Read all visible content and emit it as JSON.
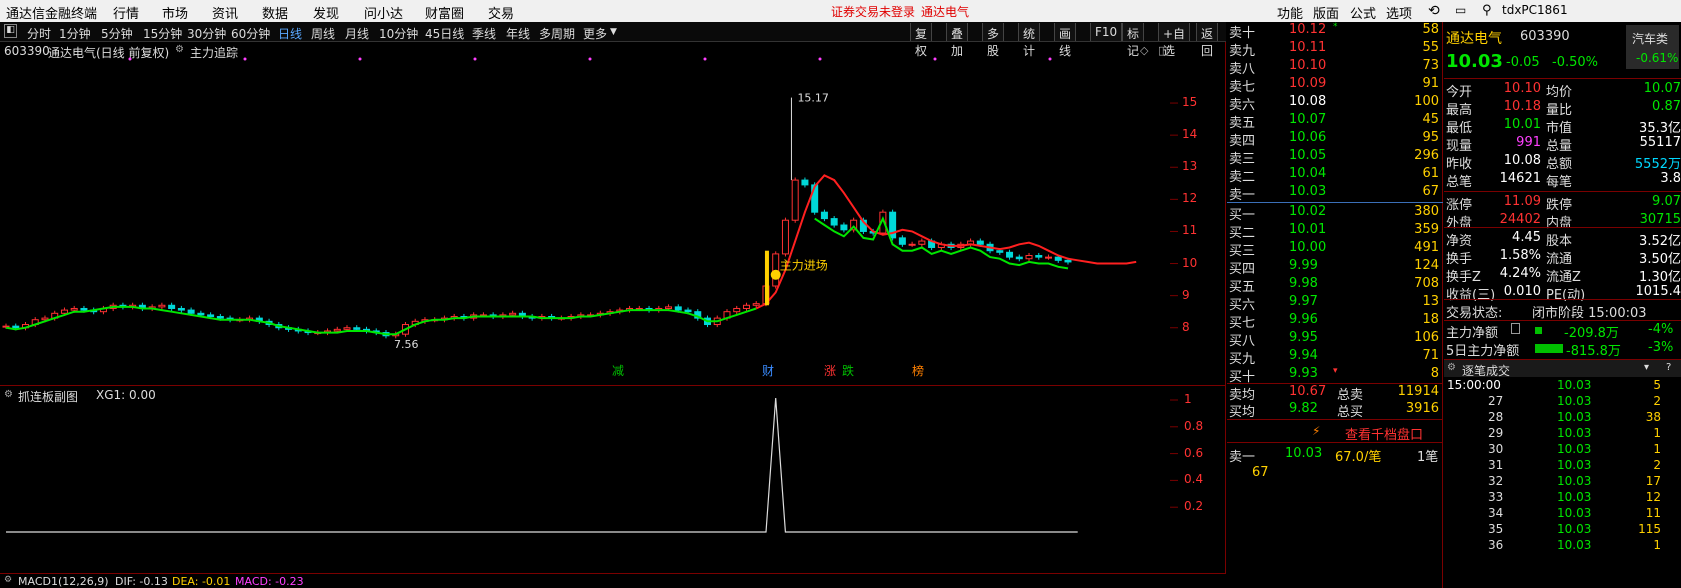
{
  "menu": {
    "app_title": "通达信金融终端",
    "items": [
      "行情",
      "市场",
      "资讯",
      "数据",
      "发现",
      "问小达",
      "财富圈",
      "交易"
    ],
    "notice_login": "证券交易未登录",
    "notice_name": "通达电气",
    "right_items": [
      "功能",
      "版面",
      "公式",
      "选项"
    ],
    "user": "tdxPC1861"
  },
  "periods": [
    "分时",
    "1分钟",
    "5分钟",
    "15分钟",
    "30分钟",
    "60分钟",
    "日线",
    "周线",
    "月线",
    "10分钟",
    "45日线",
    "季线",
    "年线",
    "多周期",
    "更多"
  ],
  "active_period": "日线",
  "toolbar": [
    "复权",
    "叠加",
    "多股",
    "统计",
    "画线",
    "F10",
    "标记",
    "+自选",
    "返回"
  ],
  "chart_header": {
    "code": "603390",
    "name_label": "通达电气(日线 前复权)",
    "indicator": "主力追踪"
  },
  "chart_data": [
    {
      "type": "candlestick",
      "y_range": [
        7.4,
        15.5
      ],
      "y_ticks": [
        15.0,
        14.0,
        13.0,
        12.0,
        11.0,
        10.0,
        9.0,
        8.0
      ],
      "high_label": "15.17",
      "low_label": "7.56",
      "signal_label": "主力进场",
      "event_tags": [
        {
          "text": "减",
          "color": "#00c000"
        },
        {
          "text": "财",
          "color": "#3b8cff"
        },
        {
          "text": "涨",
          "color": "#ff3232"
        },
        {
          "text": "跌",
          "color": "#00c000"
        },
        {
          "text": "榜",
          "color": "#ff8000"
        }
      ],
      "closes": [
        8.05,
        8.0,
        8.1,
        8.25,
        8.3,
        8.45,
        8.55,
        8.6,
        8.55,
        8.5,
        8.6,
        8.7,
        8.65,
        8.7,
        8.6,
        8.65,
        8.7,
        8.6,
        8.55,
        8.45,
        8.4,
        8.35,
        8.3,
        8.25,
        8.25,
        8.3,
        8.2,
        8.1,
        8.0,
        7.95,
        7.9,
        7.85,
        7.85,
        7.9,
        7.95,
        8.0,
        7.95,
        7.9,
        7.85,
        7.75,
        7.8,
        8.1,
        8.2,
        8.25,
        8.25,
        8.3,
        8.35,
        8.3,
        8.4,
        8.4,
        8.35,
        8.4,
        8.45,
        8.35,
        8.3,
        8.35,
        8.3,
        8.3,
        8.35,
        8.4,
        8.4,
        8.45,
        8.5,
        8.55,
        8.6,
        8.6,
        8.55,
        8.6,
        8.65,
        8.55,
        8.5,
        8.3,
        8.1,
        8.3,
        8.5,
        8.6,
        8.7,
        8.75,
        9.3,
        10.3,
        11.35,
        12.6,
        12.45,
        11.6,
        11.4,
        11.2,
        11.05,
        11.35,
        11.0,
        10.95,
        11.6,
        10.8,
        10.6,
        10.6,
        10.7,
        10.5,
        10.6,
        10.5,
        10.6,
        10.7,
        10.6,
        10.4,
        10.35,
        10.2,
        10.15,
        10.25,
        10.2,
        10.2,
        10.1,
        10.05
      ],
      "ma_green": [
        8.0,
        7.95,
        8.0,
        8.1,
        8.2,
        8.3,
        8.4,
        8.5,
        8.5,
        8.55,
        8.6,
        8.65,
        8.65,
        8.65,
        8.6,
        8.6,
        8.55,
        8.5,
        8.45,
        8.4,
        8.35,
        8.3,
        8.25,
        8.25,
        8.25,
        8.25,
        8.2,
        8.15,
        8.05,
        8.0,
        7.95,
        7.9,
        7.85,
        7.85,
        7.85,
        7.9,
        7.9,
        7.9,
        7.85,
        7.8,
        7.8,
        7.95,
        8.1,
        8.2,
        8.25,
        8.25,
        8.3,
        8.3,
        8.35,
        8.35,
        8.35,
        8.35,
        8.35,
        8.35,
        8.35,
        8.3,
        8.3,
        8.3,
        8.3,
        8.35,
        8.35,
        8.4,
        8.45,
        8.5,
        8.55,
        8.55,
        8.55,
        8.55,
        8.55,
        8.5,
        8.45,
        8.35,
        8.2,
        8.2,
        8.3,
        8.4,
        8.5,
        8.6
      ],
      "ma_red": [
        8.6,
        8.75,
        9.1,
        9.8,
        10.7,
        11.6,
        12.4,
        12.75,
        12.6,
        12.2,
        11.75,
        11.3,
        11.0,
        10.9,
        10.95,
        11.05,
        11.0,
        10.85,
        10.7,
        10.6,
        10.55,
        10.55,
        10.6,
        10.55,
        10.5,
        10.45,
        10.5,
        10.6,
        10.65,
        10.55,
        10.4,
        10.25,
        10.15,
        10.1,
        10.05,
        10.0,
        10.0,
        10.0,
        10.0,
        10.05
      ],
      "dots": 9
    },
    {
      "type": "area",
      "name": "抓连板副图",
      "label": "XG1: 0.00",
      "y_ticks": [
        1.0,
        0.8,
        0.6,
        0.4,
        0.2
      ],
      "values": [
        0,
        0,
        0,
        0,
        0,
        0,
        0,
        0,
        0,
        0,
        0,
        0,
        0,
        0,
        0,
        0,
        0,
        0,
        0,
        0,
        0,
        0,
        0,
        0,
        0,
        0,
        0,
        0,
        0,
        0,
        0,
        0,
        0,
        0,
        0,
        0,
        0,
        0,
        0,
        0,
        0,
        0,
        0,
        0,
        0,
        0,
        0,
        0,
        0,
        0,
        0,
        0,
        0,
        0,
        0,
        0,
        0,
        0,
        0,
        0,
        0,
        0,
        0,
        0,
        0,
        0,
        0,
        0,
        0,
        0,
        0,
        0,
        0,
        0,
        0,
        0,
        0,
        0,
        0,
        1,
        0,
        0,
        0,
        0,
        0,
        0,
        0,
        0,
        0,
        0,
        0,
        0,
        0,
        0,
        0,
        0,
        0,
        0,
        0,
        0,
        0,
        0,
        0,
        0,
        0,
        0,
        0,
        0,
        0,
        0,
        0
      ]
    }
  ],
  "macd": {
    "name": "MACD1(12,26,9)",
    "dif": "DIF: -0.13",
    "dea": "DEA: -0.01",
    "macd": "MACD: -0.23"
  },
  "orderbook": {
    "asks": [
      {
        "l": "卖十",
        "p": "10.12",
        "v": "58",
        "mark": "*"
      },
      {
        "l": "卖九",
        "p": "10.11",
        "v": "55"
      },
      {
        "l": "卖八",
        "p": "10.10",
        "v": "73"
      },
      {
        "l": "卖七",
        "p": "10.09",
        "v": "91"
      },
      {
        "l": "卖六",
        "p": "10.08",
        "v": "100"
      },
      {
        "l": "卖五",
        "p": "10.07",
        "v": "45"
      },
      {
        "l": "卖四",
        "p": "10.06",
        "v": "95"
      },
      {
        "l": "卖三",
        "p": "10.05",
        "v": "296"
      },
      {
        "l": "卖二",
        "p": "10.04",
        "v": "61"
      },
      {
        "l": "卖一",
        "p": "10.03",
        "v": "67"
      }
    ],
    "bids": [
      {
        "l": "买一",
        "p": "10.02",
        "v": "380"
      },
      {
        "l": "买二",
        "p": "10.01",
        "v": "359"
      },
      {
        "l": "买三",
        "p": "10.00",
        "v": "491"
      },
      {
        "l": "买四",
        "p": "9.99",
        "v": "124"
      },
      {
        "l": "买五",
        "p": "9.98",
        "v": "708"
      },
      {
        "l": "买六",
        "p": "9.97",
        "v": "13"
      },
      {
        "l": "买七",
        "p": "9.96",
        "v": "18"
      },
      {
        "l": "买八",
        "p": "9.95",
        "v": "106"
      },
      {
        "l": "买九",
        "p": "9.94",
        "v": "71"
      },
      {
        "l": "买十",
        "p": "9.93",
        "v": "8",
        "mark": "▾"
      }
    ],
    "avg": [
      {
        "l": "卖均",
        "p": "10.67",
        "k": "总卖",
        "v": "11914"
      },
      {
        "l": "买均",
        "p": "9.82",
        "k": "总买",
        "v": "3916"
      }
    ],
    "level_btn": "查看千档盘口",
    "detail": {
      "l": "卖一",
      "p": "10.03",
      "q": "67.0/笔",
      "n": "1笔",
      "sub": "67"
    }
  },
  "quote": {
    "name": "通达电气",
    "code": "603390",
    "sector": "汽车类",
    "price": "10.03",
    "chg": "-0.05",
    "pct": "-0.50%",
    "sector_pct": "-0.61%",
    "rows1": [
      [
        "今开",
        "10.10",
        "均价",
        "10.07"
      ],
      [
        "最高",
        "10.18",
        "量比",
        "0.87"
      ],
      [
        "最低",
        "10.01",
        "市值",
        "35.3亿"
      ],
      [
        "现量",
        "991",
        "总量",
        "55117"
      ],
      [
        "昨收",
        "10.08",
        "总额",
        "5552万"
      ],
      [
        "总笔",
        "14621",
        "每笔",
        "3.8"
      ]
    ],
    "rows2": [
      [
        "涨停",
        "11.09",
        "跌停",
        "9.07"
      ],
      [
        "外盘",
        "24402",
        "内盘",
        "30715"
      ]
    ],
    "rows3": [
      [
        "净资",
        "4.45",
        "股本",
        "3.52亿"
      ],
      [
        "换手",
        "1.58%",
        "流通",
        "3.50亿"
      ],
      [
        "换手Z",
        "4.24%",
        "流通Z",
        "1.30亿"
      ],
      [
        "收益(三)",
        "0.010",
        "PE(动)",
        "1015.4"
      ]
    ],
    "status_label": "交易状态:",
    "status_value": "闭市阶段 15:00:03",
    "flow": [
      {
        "l": "主力净额",
        "v": "-209.8万",
        "p": "-4%"
      },
      {
        "l": "5日主力净额",
        "v": "-815.8万",
        "p": "-3%"
      }
    ],
    "trades_title": "逐笔成交",
    "trades": [
      [
        "15:00:00",
        "10.03",
        "5"
      ],
      [
        "27",
        "10.03",
        "2"
      ],
      [
        "28",
        "10.03",
        "38"
      ],
      [
        "29",
        "10.03",
        "1"
      ],
      [
        "30",
        "10.03",
        "1"
      ],
      [
        "31",
        "10.03",
        "2"
      ],
      [
        "32",
        "10.03",
        "17"
      ],
      [
        "33",
        "10.03",
        "12"
      ],
      [
        "34",
        "10.03",
        "11"
      ],
      [
        "35",
        "10.03",
        "115"
      ],
      [
        "36",
        "10.03",
        "1"
      ]
    ]
  }
}
